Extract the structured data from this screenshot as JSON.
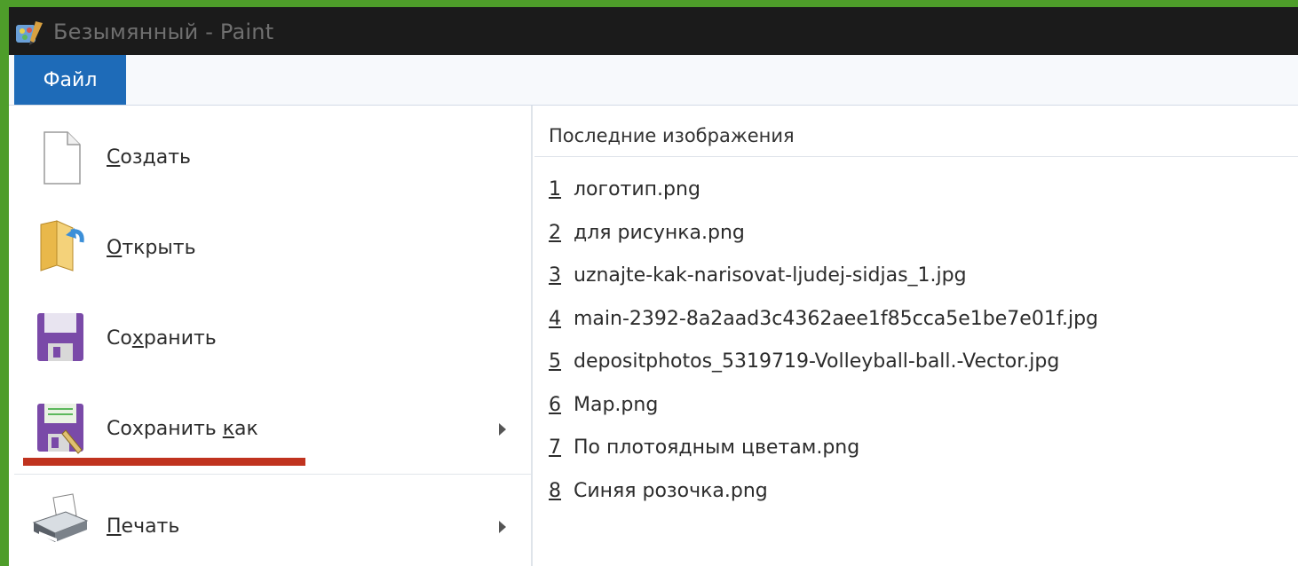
{
  "window": {
    "title": "Безымянный - Paint"
  },
  "ribbon": {
    "file_tab": "Файл"
  },
  "file_menu": {
    "items": [
      {
        "prefix": "",
        "accel": "С",
        "suffix": "оздать",
        "icon": "new-document-icon",
        "has_submenu": false
      },
      {
        "prefix": "",
        "accel": "О",
        "suffix": "ткрыть",
        "icon": "open-folder-icon",
        "has_submenu": false
      },
      {
        "prefix": "Со",
        "accel": "х",
        "suffix": "ранить",
        "icon": "save-disk-icon",
        "has_submenu": false
      },
      {
        "prefix": "Сохранить ",
        "accel": "к",
        "suffix": "ак",
        "icon": "save-as-icon",
        "has_submenu": true
      },
      {
        "prefix": "",
        "accel": "П",
        "suffix": "ечать",
        "icon": "printer-icon",
        "has_submenu": true
      }
    ]
  },
  "recent": {
    "title": "Последние изображения",
    "items": [
      {
        "num": "1",
        "name": "логотип.png"
      },
      {
        "num": "2",
        "name": "для рисунка.png"
      },
      {
        "num": "3",
        "name": "uznajte-kak-narisovat-ljudej-sidjas_1.jpg"
      },
      {
        "num": "4",
        "name": "main-2392-8a2aad3c4362aee1f85cca5e1be7e01f.jpg"
      },
      {
        "num": "5",
        "name": "depositphotos_5319719-Volleyball-ball.-Vector.jpg"
      },
      {
        "num": "6",
        "name": "Map.png"
      },
      {
        "num": "7",
        "name": "По плотоядным цветам.png"
      },
      {
        "num": "8",
        "name": "Синяя розочка.png"
      }
    ]
  },
  "colors": {
    "frame_border": "#4e9d2a",
    "titlebar": "#1b1b1b",
    "file_tab": "#1e6bb8",
    "highlight_underline": "#c0331f"
  }
}
